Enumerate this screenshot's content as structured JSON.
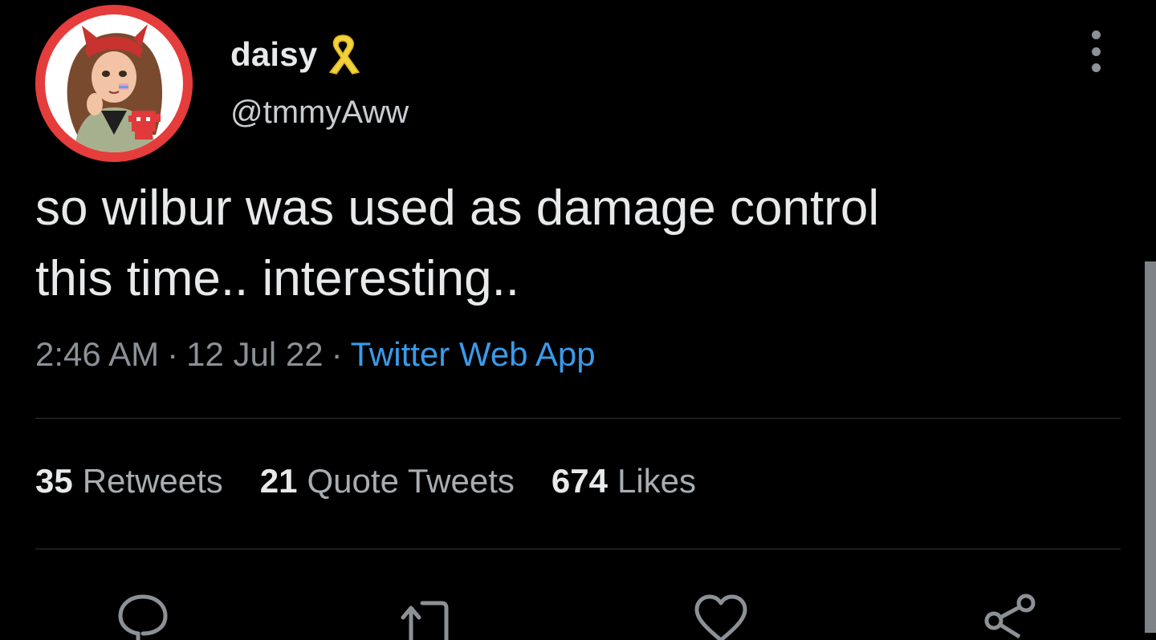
{
  "tweet": {
    "author": {
      "display_name": "daisy",
      "handle": "@tmmyAww"
    },
    "text_lines": [
      "so wilbur was used as damage control",
      "this time.. interesting.."
    ],
    "meta": {
      "time": "2:46 AM",
      "date": "12 Jul 22",
      "separator": "·",
      "source": "Twitter Web App"
    },
    "stats": {
      "retweets": {
        "count": "35",
        "label": "Retweets"
      },
      "quote_tweets": {
        "count": "21",
        "label": "Quote Tweets"
      },
      "likes": {
        "count": "674",
        "label": "Likes"
      }
    }
  },
  "icons": {
    "author_badge": "yellow-ribbon-icon",
    "menu": "more-vertical-icon",
    "reply": "reply-icon",
    "retweet": "retweet-icon",
    "like": "heart-icon",
    "share": "share-icon"
  },
  "colors": {
    "background": "#000000",
    "text_primary": "#e7e9ea",
    "text_secondary": "#8b9196",
    "link": "#3a9bea",
    "divider": "#2f3336",
    "ribbon": "#f4d23c",
    "avatar_ring": "#e43d3b"
  }
}
